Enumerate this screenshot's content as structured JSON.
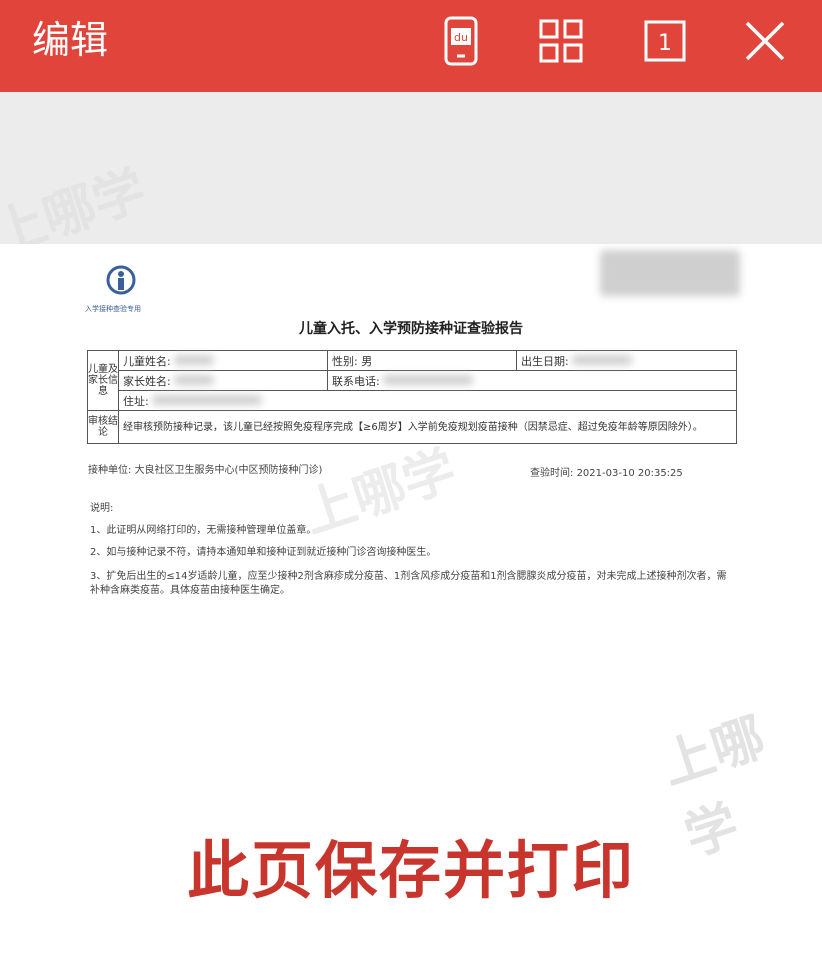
{
  "header": {
    "title": "编辑",
    "icons": [
      "phone-du-icon",
      "grid-icon",
      "page-one-icon",
      "close-icon"
    ],
    "page_badge": "1",
    "du_label": "du",
    "accent": "#e0443a"
  },
  "watermark": {
    "text": "上哪学"
  },
  "document": {
    "logo_label": "入学接种查验专用",
    "title": "儿童入托、入学预防接种证查验报告",
    "section_child": "儿童及家长信息",
    "child_name_label": "儿童姓名:",
    "gender_label": "性别:",
    "gender_value": "男",
    "birth_label": "出生日期:",
    "parent_name_label": "家长姓名:",
    "phone_label": "联系电话:",
    "address_label": "住址:",
    "section_review": "审核结论",
    "review_text": "经审核预防接种记录，该儿童已经按照免疫程序完成【≥6周岁】入学前免疫规划疫苗接种（因禁忌症、超过免疫年龄等原因除外）。",
    "unit_label": "接种单位:",
    "unit_value": "大良社区卫生服务中心(中区预防接种门诊)",
    "time_label": "查验时间:",
    "time_value": "2021-03-10 20:35:25",
    "notes_title": "说明:",
    "notes": [
      "1、此证明从网络打印的，无需接种管理单位盖章。",
      "2、如与接种记录不符，请持本通知单和接种证到就近接种门诊咨询接种医生。",
      "3、扩免后出生的≤14岁适龄儿童，应至少接种2剂含麻疹成分疫苗、1剂含风疹成分疫苗和1剂含腮腺炎成分疫苗，对未完成上述接种剂次者，需补种含麻类疫苗。具体疫苗由接种医生确定。"
    ]
  },
  "caption": "此页保存并打印"
}
